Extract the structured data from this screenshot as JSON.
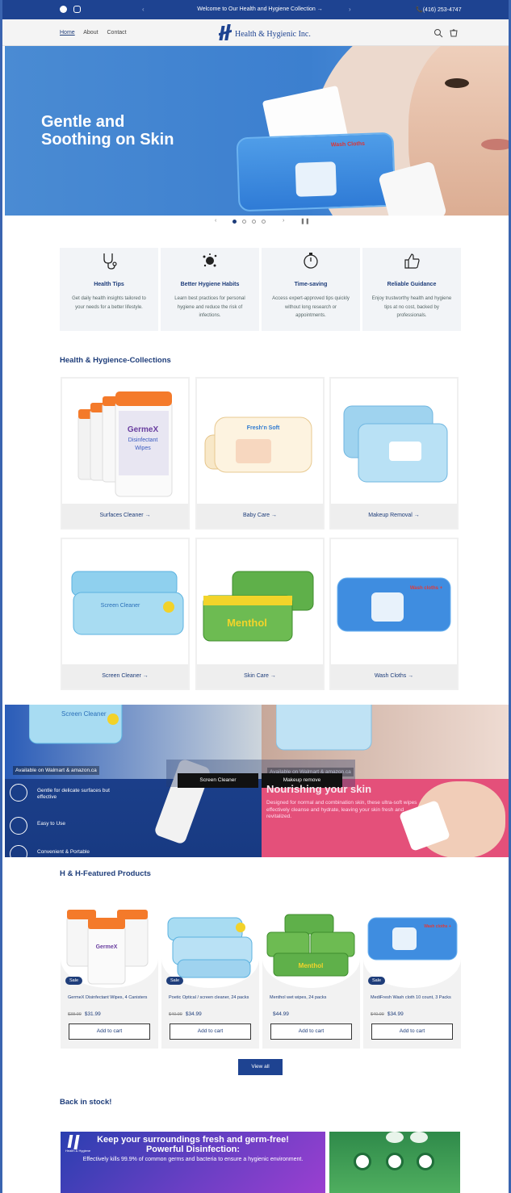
{
  "announcement": {
    "message": "Welcome to Our Health and Hygiene Collection →",
    "phone": "(416) 253-4747"
  },
  "header": {
    "nav": [
      "Home",
      "About",
      "Contact"
    ],
    "brand": "Health & Hygienic Inc."
  },
  "hero": {
    "headline": "Gentle and\nSoothing on Skin",
    "pack_label": "Wash Cloths"
  },
  "features": [
    {
      "title": "Health Tips",
      "text": "Get daily health insights tailored to your needs for a better lifestyle."
    },
    {
      "title": "Better Hygiene Habits",
      "text": "Learn best practices for personal hygiene and reduce the risk of infections."
    },
    {
      "title": "Time-saving",
      "text": "Access expert-approved tips quickly without long research or appointments."
    },
    {
      "title": "Reliable Guidance",
      "text": "Enjoy trustworthy health and hygiene tips at no cost, backed by professionals."
    }
  ],
  "collections": {
    "title": "Health & Hygience-Collections",
    "items": [
      "Surfaces Cleaner →",
      "Baby Care →",
      "Makeup Removal →",
      "Screen Cleaner →",
      "Skin Care →",
      "Wash Cloths →"
    ]
  },
  "banner": {
    "available_left": "Available on Walmart & amazon.ca",
    "available_right": "Available on Walmart & amazon.ca",
    "tab_left": "Screen Cleaner",
    "tab_right": "Makeup remove",
    "features": [
      "Gentle for delicate surfaces but effective",
      "Easy to Use",
      "Convenient & Portable"
    ],
    "right_headline": "Nourishing your skin",
    "right_text": "Designed for normal and combination skin, these ultra-soft wipes effectively cleanse and hydrate, leaving your skin fresh and revitalized."
  },
  "featured": {
    "title": "H & H-Featured Products",
    "sale_label": "Sale",
    "add_label": "Add to cart",
    "products": [
      {
        "name": "GermeX Disinfectant Wipes, 4 Canisters",
        "old": "$38.99",
        "price": "$31.99"
      },
      {
        "name": "Poetic Optical / screen cleaner, 24 packs",
        "old": "$40.99",
        "price": "$34.99"
      },
      {
        "name": "Menthol wet wipes, 24 packs",
        "old": "",
        "price": "$44.99"
      },
      {
        "name": "MediFresh Wash cloth 10 count, 3 Packs",
        "old": "$40.99",
        "price": "$34.99"
      }
    ],
    "view_all": "View all"
  },
  "back_in_stock": {
    "title": "Back in stock!",
    "promo_line1": "Keep your surroundings fresh and germ-free!",
    "promo_line2": "Powerful Disinfection:",
    "promo_text": "Effectively kills 99.9% of common germs and bacteria to ensure a hygienic environment.",
    "promo_logo": "Health & Hygiene"
  },
  "colors": {
    "brand_blue": "#1e4391",
    "text_navy": "#1e3d7a",
    "accent_pink": "#e4507a"
  }
}
